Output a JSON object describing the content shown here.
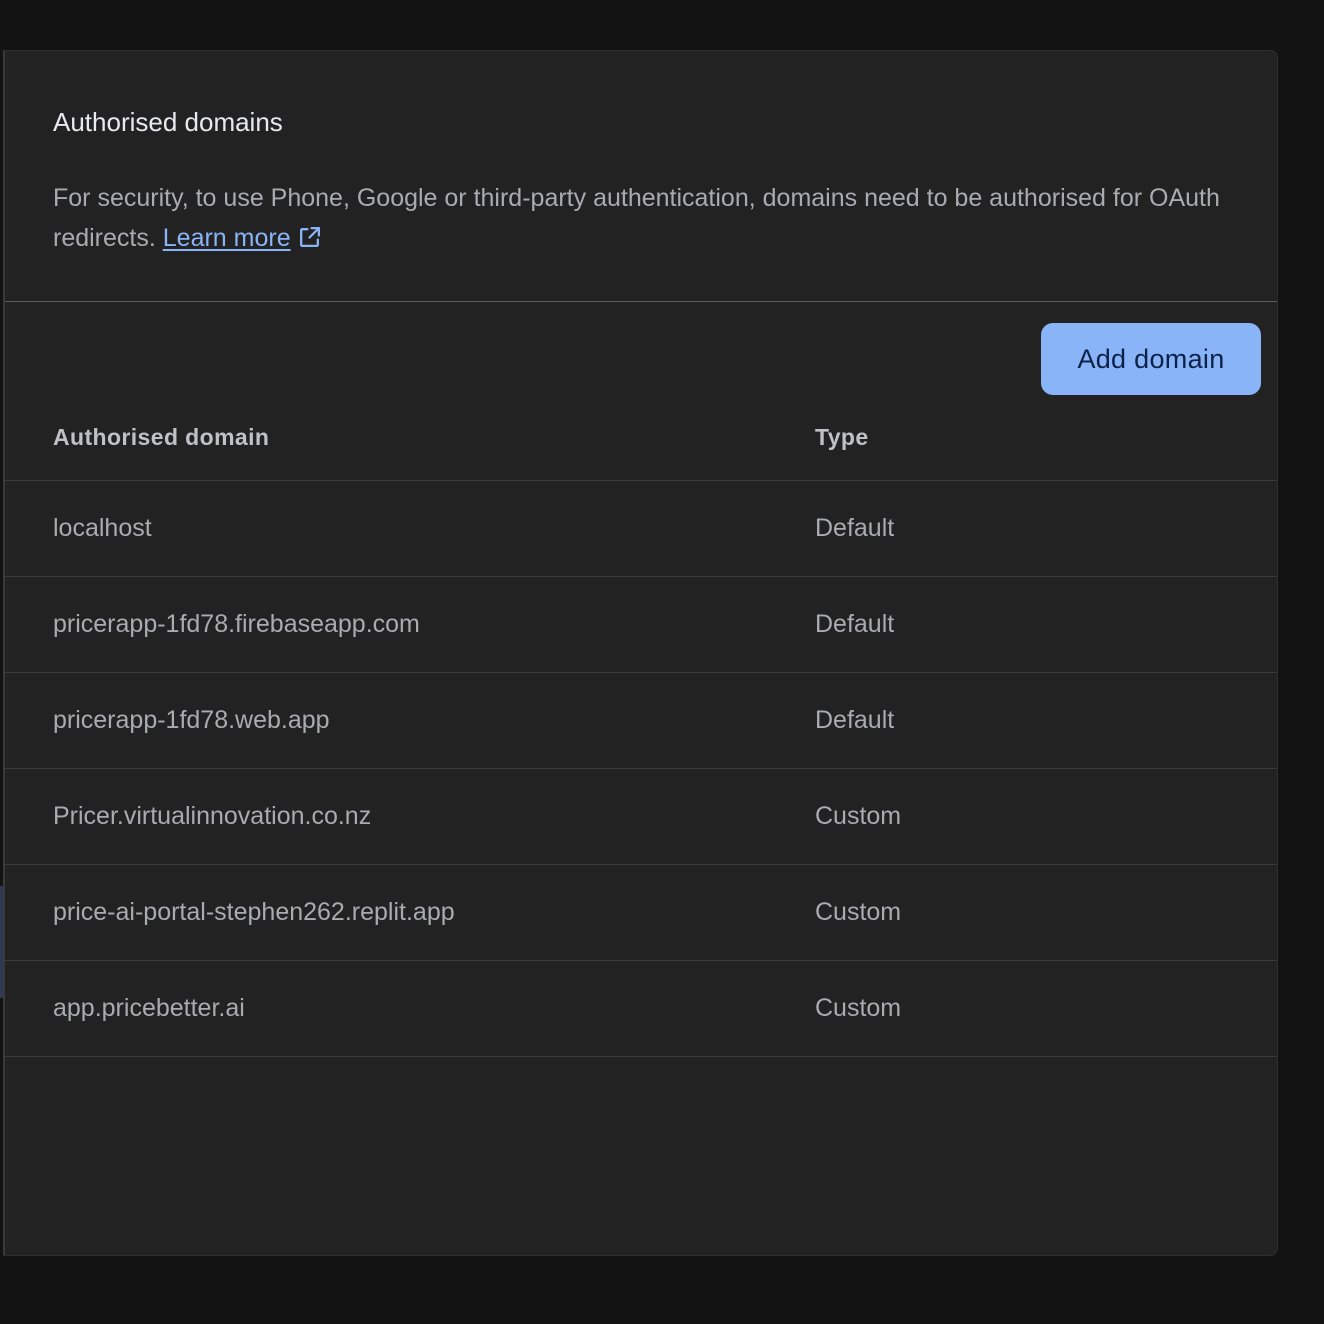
{
  "card": {
    "title": "Authorised domains",
    "description": "For security, to use Phone, Google or third-party authentication, domains need to be authorised for OAuth redirects.",
    "learn_more_label": "Learn more"
  },
  "toolbar": {
    "add_domain_label": "Add domain"
  },
  "table": {
    "headers": {
      "domain": "Authorised domain",
      "type": "Type"
    },
    "rows": [
      {
        "domain": "localhost",
        "type": "Default"
      },
      {
        "domain": "pricerapp-1fd78.firebaseapp.com",
        "type": "Default"
      },
      {
        "domain": "pricerapp-1fd78.web.app",
        "type": "Default"
      },
      {
        "domain": "Pricer.virtualinnovation.co.nz",
        "type": "Custom"
      },
      {
        "domain": "price-ai-portal-stephen262.replit.app",
        "type": "Custom"
      },
      {
        "domain": "app.pricebetter.ai",
        "type": "Custom"
      }
    ]
  },
  "colors": {
    "background": "#131313",
    "card": "#222223",
    "accent": "#8ab4f8",
    "button_text": "#0d2249"
  },
  "icons": {
    "external_link": "open-in-new-icon"
  }
}
